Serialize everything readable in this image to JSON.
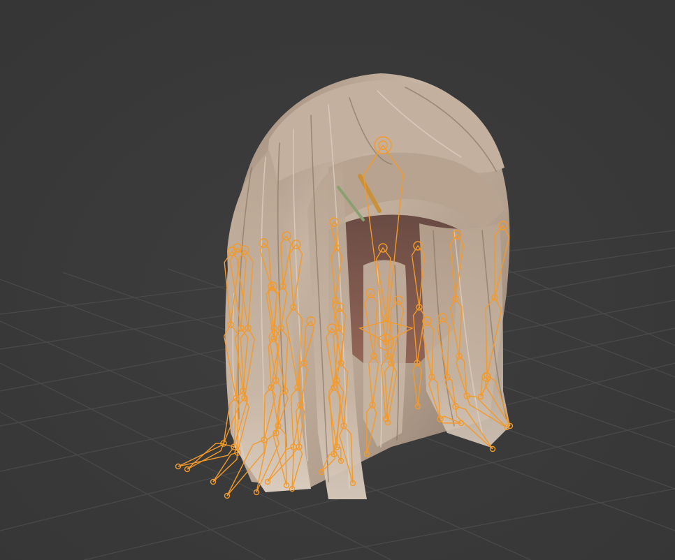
{
  "viewport": {
    "background_color": "#3a3a3a",
    "grid_color": "#4a4a4a",
    "horizon_glow": "#3f3f3f"
  },
  "model": {
    "hair_base_color": "#b9a592",
    "hair_shadow_color": "#6e5a4c",
    "hair_highlight_color": "#d8cabb",
    "inner_color": "#7a4a40"
  },
  "armature": {
    "bone_color": "#f39a2a",
    "display": "octahedral",
    "selected": true
  },
  "accessories": [
    "hairpin-gold",
    "hairpin-green"
  ]
}
